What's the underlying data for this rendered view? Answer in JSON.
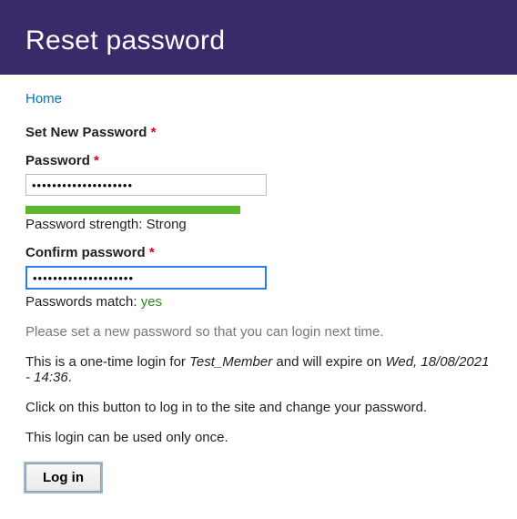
{
  "banner": {
    "title": "Reset password"
  },
  "breadcrumb": {
    "home": "Home"
  },
  "form": {
    "heading": "Set New Password",
    "required_mark": "*",
    "password": {
      "label": "Password",
      "value": "••••••••••••••••••••",
      "strength_label": "Password strength: ",
      "strength_value": "Strong"
    },
    "confirm": {
      "label": "Confirm password",
      "value": "••••••••••••••••••••",
      "match_label": "Passwords match: ",
      "match_value": "yes"
    }
  },
  "messages": {
    "instruction": "Please set a new password so that you can login next time.",
    "one_time_prefix": "This is a one-time login for ",
    "username": "Test_Member",
    "one_time_mid": " and will expire on ",
    "expiry": "Wed, 18/08/2021 - 14:36",
    "one_time_suffix": ".",
    "click_button": "Click on this button to log in to the site and change your password.",
    "once_only": "This login can be used only once."
  },
  "actions": {
    "login": "Log in"
  }
}
